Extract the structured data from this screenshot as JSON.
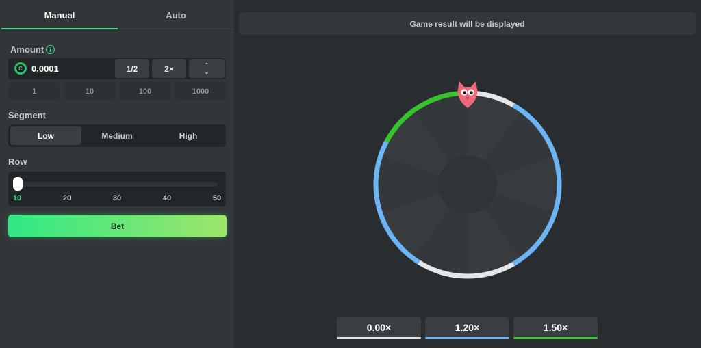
{
  "tabs": [
    {
      "label": "Manual"
    },
    {
      "label": "Auto"
    }
  ],
  "amount": {
    "label": "Amount",
    "info_icon": "info-icon",
    "coin_icon": "coin-icon",
    "coin_glyph": "C",
    "value": "0.0001",
    "half_label": "1/2",
    "double_label": "2×",
    "stepper_up": "⌃",
    "stepper_down": "⌄",
    "quick": [
      "1",
      "10",
      "100",
      "1000"
    ]
  },
  "segment": {
    "label": "Segment",
    "options": [
      "Low",
      "Medium",
      "High"
    ],
    "selected": "Low"
  },
  "row": {
    "label": "Row",
    "ticks": [
      "10",
      "20",
      "30",
      "40",
      "50"
    ],
    "value": 10
  },
  "bet": {
    "label": "Bet"
  },
  "result": {
    "text": "Game result will be displayed"
  },
  "wheel": {
    "pointer_icon": "owl-icon",
    "segments": 10,
    "colors": {
      "green": "#36c32b",
      "white": "#e4e6e8",
      "blue": "#6cb4f3",
      "slice": "#383c3e",
      "slice_alt": "#34383a",
      "hub": "#303436"
    }
  },
  "multipliers": [
    {
      "label": "0.00×",
      "color": "#e4e6e8"
    },
    {
      "label": "1.20×",
      "color": "#6cb4f3"
    },
    {
      "label": "1.50×",
      "color": "#36c32b"
    }
  ],
  "accent": "#3ddc84"
}
